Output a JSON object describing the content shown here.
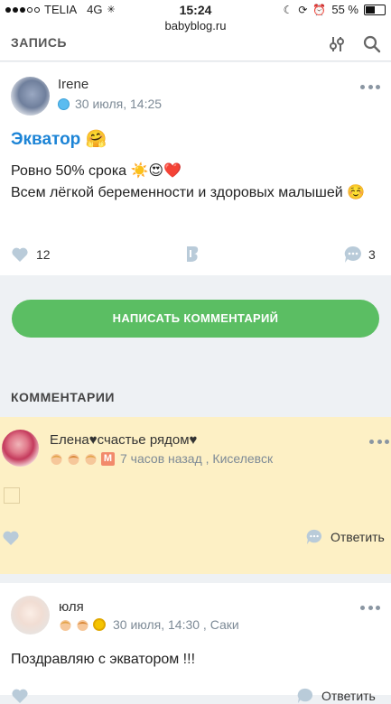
{
  "status": {
    "carrier": "TELIA",
    "network": "4G",
    "time": "15:24",
    "battery": "55 %",
    "url": "babyblog.ru"
  },
  "nav": {
    "title": "ЗАПИСЬ",
    "filter_icon": "filter-icon",
    "search_icon": "search-icon"
  },
  "post": {
    "author": "Irene",
    "date": "30 июля, 14:25",
    "title": "Экватор 🤗",
    "body_line1": "Ровно 50% срока ☀️😍❤️",
    "body_line2": "Всем лёгкой беременности и здоровых малышей ☺️",
    "likes": "12",
    "comments": "3"
  },
  "comment_button": "НАПИСАТЬ КОММЕНТАРИЙ",
  "comments_header": "КОММЕНТАРИИ",
  "comments": [
    {
      "name": "Елена♥счастье рядом♥",
      "badge_m": "М",
      "meta": "7 часов назад , Киселевск",
      "reply": "Ответить"
    },
    {
      "name": "юля",
      "meta": "30 июля, 14:30 , Саки",
      "text": "Поздравляю с экватором !!!",
      "reply": "Ответить"
    }
  ],
  "colors": {
    "accent_blue": "#1c84d6",
    "button_green": "#5bbe63",
    "highlight": "#fdf0c5",
    "muted": "#7d8a96"
  }
}
